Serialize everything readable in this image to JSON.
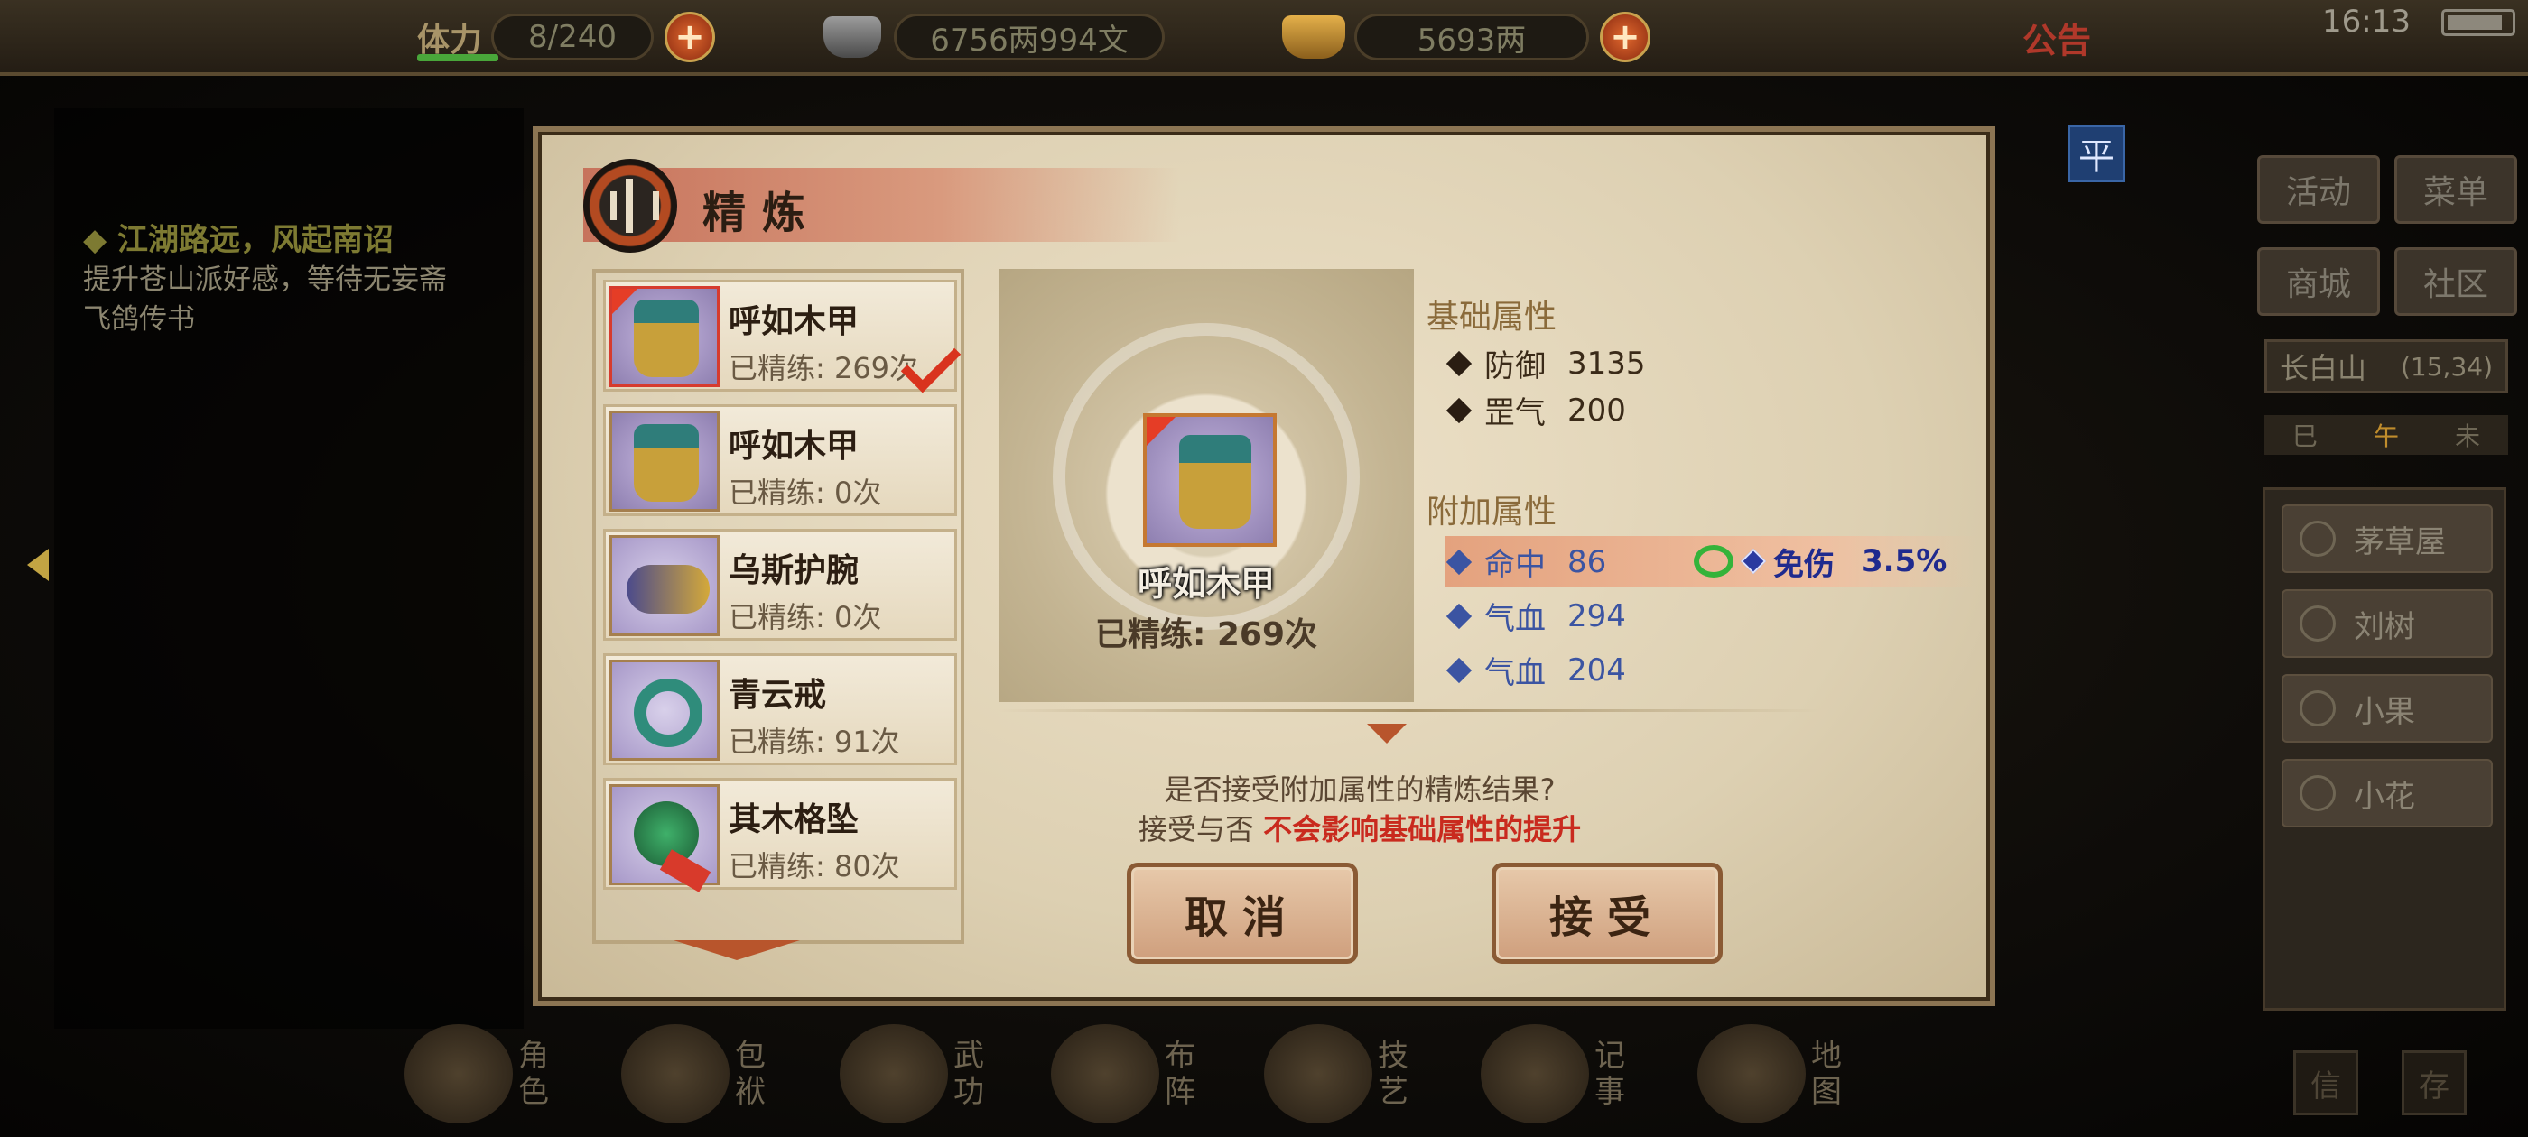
{
  "topbar": {
    "stamina_label": "体力",
    "stamina_value": "8/240",
    "silver_value": "6756两994文",
    "gold_value": "5693两",
    "notice_label": "公告",
    "time": "16:13"
  },
  "quest": {
    "title": "◆ 江湖路远，风起南诏",
    "description": "提升苍山派好感，等待无妄斋飞鸽传书"
  },
  "side_menu": {
    "flat_badge": "平",
    "buttons": [
      "活动",
      "菜单",
      "商城",
      "社区"
    ],
    "location_name": "长白山",
    "location_coord": "(15,34)",
    "time_slots": [
      "巳",
      "午",
      "未"
    ],
    "npcs": [
      "茅草屋",
      "刘树",
      "小果",
      "小花"
    ],
    "corner_buttons": [
      "信",
      "存"
    ]
  },
  "bottom_nav": [
    "角色",
    "包袱",
    "武功",
    "布阵",
    "技艺",
    "记事",
    "地图"
  ],
  "dialog": {
    "title": "精炼",
    "items": [
      {
        "name": "呼如木甲",
        "count": "已精练: 269次",
        "icon": "armor-icon"
      },
      {
        "name": "呼如木甲",
        "count": "已精练: 0次",
        "icon": "armor-icon"
      },
      {
        "name": "乌斯护腕",
        "count": "已精练: 0次",
        "icon": "bracer-icon"
      },
      {
        "name": "青云戒",
        "count": "已精练: 91次",
        "icon": "ring-icon"
      },
      {
        "name": "其木格坠",
        "count": "已精练: 80次",
        "icon": "pendant-icon"
      }
    ],
    "preview": {
      "name": "呼如木甲",
      "count": "已精练: 269次"
    },
    "base_title": "基础属性",
    "base_attrs": [
      {
        "name": "防御",
        "value": "3135"
      },
      {
        "name": "罡气",
        "value": "200"
      }
    ],
    "extra_title": "附加属性",
    "extra_attrs": [
      {
        "name": "命中",
        "value": "86"
      },
      {
        "name": "气血",
        "value": "294"
      },
      {
        "name": "气血",
        "value": "204"
      }
    ],
    "bonus": {
      "name": "免伤",
      "value": "3.5%"
    },
    "question_line1": "是否接受附加属性的精炼结果?",
    "question_line2_prefix": "接受与否",
    "question_line2_highlight": "不会影响基础属性的提升",
    "cancel_label": "取消",
    "accept_label": "接受"
  },
  "colors": {
    "accent_red": "#c92a1e",
    "attr_blue": "#3b54a2",
    "bonus_green": "#34b33a"
  }
}
